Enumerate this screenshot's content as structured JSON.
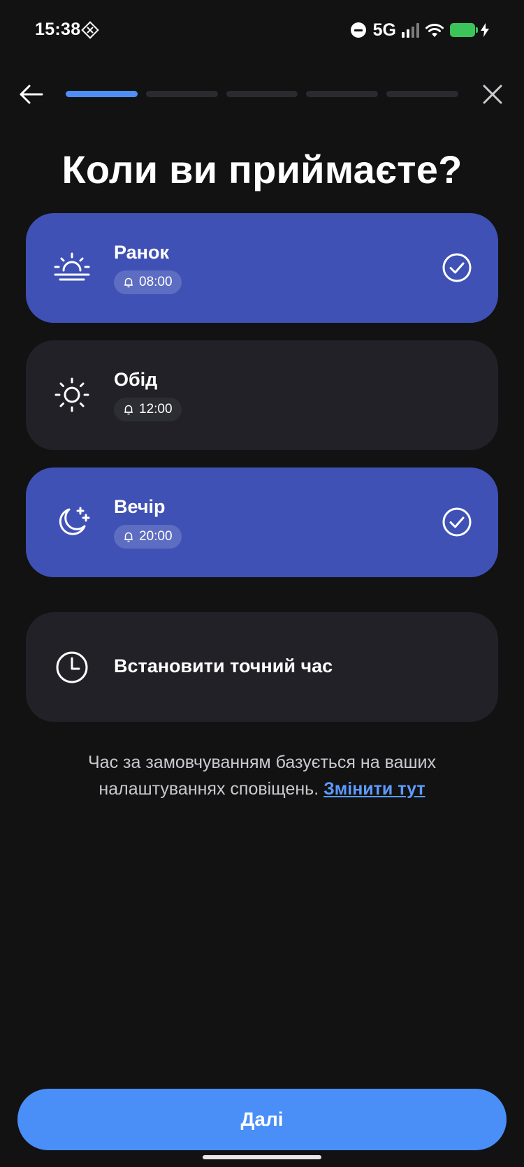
{
  "status_bar": {
    "time": "15:38",
    "network": "5G",
    "icons": [
      "diamond-grid-icon",
      "do-not-disturb-icon",
      "signal-icon",
      "wifi-icon",
      "battery-charging-icon"
    ],
    "battery_color": "#3ac45a"
  },
  "nav": {
    "back_icon": "arrow-left-icon",
    "close_icon": "close-icon",
    "progress_steps": 5,
    "progress_current": 1,
    "progress_color": "#4f8ef7"
  },
  "title": "Коли ви приймаєте?",
  "options": [
    {
      "label": "Ранок",
      "time": "08:00",
      "icon": "sunrise-icon",
      "selected": true
    },
    {
      "label": "Обід",
      "time": "12:00",
      "icon": "sun-icon",
      "selected": false
    },
    {
      "label": "Вечір",
      "time": "20:00",
      "icon": "moon-stars-icon",
      "selected": true
    }
  ],
  "exact_time": {
    "label": "Встановити точний час",
    "icon": "clock-icon"
  },
  "note": {
    "text": "Час за замовчуванням базується на ваших налаштуваннях сповіщень.",
    "link": "Змінити тут"
  },
  "next_button": "Далі",
  "colors": {
    "background": "#121212",
    "card": "#212127",
    "card_selected": "#3f51b5",
    "accent": "#4a8ef8",
    "link": "#5d9bff"
  }
}
